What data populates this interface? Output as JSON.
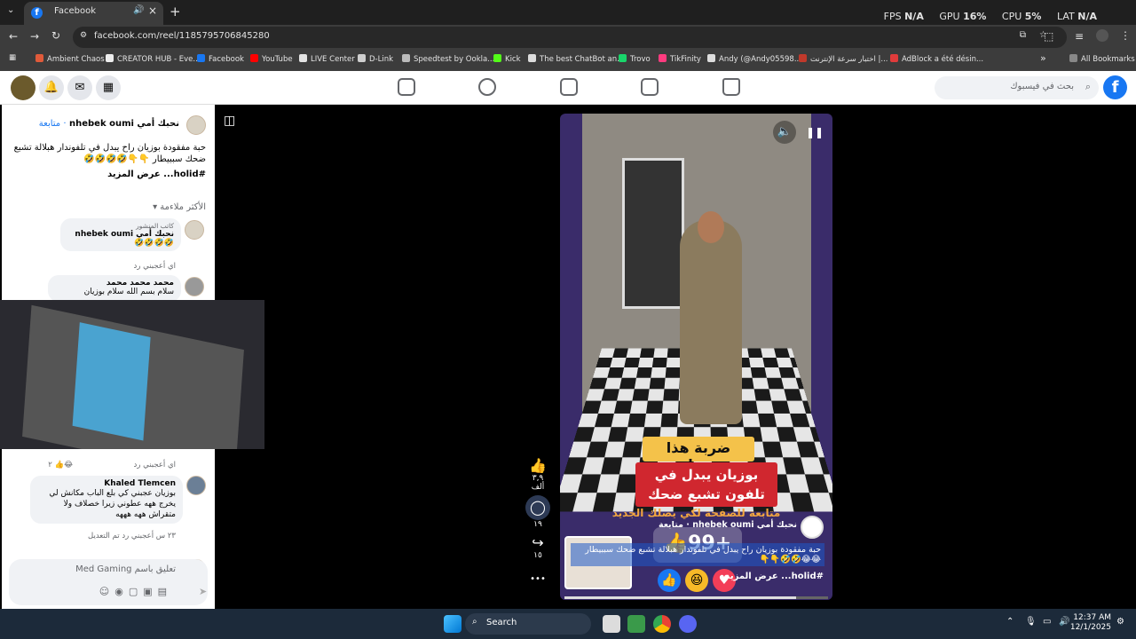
{
  "browser": {
    "tab_title": "Facebook",
    "tab_favicon": "f",
    "new_tab": "+",
    "close_tab": "×",
    "url": "facebook.com/reel/1185795706845280",
    "perf": {
      "fps_label": "FPS",
      "fps_value": "N/A",
      "gpu_label": "GPU",
      "gpu_value": "16%",
      "cpu_label": "CPU",
      "cpu_value": "5%",
      "lat_label": "LAT",
      "lat_value": "N/A"
    },
    "bookmarks": [
      {
        "label": "Ambient Chaos",
        "color": "#e05a3a"
      },
      {
        "label": "CREATOR HUB - Eve...",
        "color": "#eeeeee"
      },
      {
        "label": "Facebook",
        "color": "#1877f2"
      },
      {
        "label": "YouTube",
        "color": "#ff0000"
      },
      {
        "label": "LIVE Center",
        "color": "#e3e3e3"
      },
      {
        "label": "D-Link",
        "color": "#cfcfcf"
      },
      {
        "label": "Speedtest by Ookla...",
        "color": "#bbbbbb"
      },
      {
        "label": "Kick",
        "color": "#53fc18"
      },
      {
        "label": "The best ChatBot an...",
        "color": "#dddddd"
      },
      {
        "label": "Trovo",
        "color": "#19d66b"
      },
      {
        "label": "TikFinity",
        "color": "#ff3b7f"
      },
      {
        "label": "Andy (@Andy05598...",
        "color": "#dddddd"
      },
      {
        "label": "اختبار سرعة الإنترنت |...",
        "color": "#c0392b"
      },
      {
        "label": "AdBlock a été désin...",
        "color": "#e03b3b"
      }
    ],
    "all_bookmarks": "All Bookmarks"
  },
  "fb": {
    "search_placeholder": "بحث في فيسبوك",
    "logo": "f"
  },
  "post": {
    "author": "نحبك أمي nhebek oumi",
    "follow": "متابعة",
    "caption": "حبة مفقودة بوزيان راح يبدل في تلفوندار هبلالة تشبع ضحك سببيطار 👇👇🤣🤣🤣🤣",
    "see_more": "#holid... عرض المزيد",
    "sort": "الأكثر ملاءمة"
  },
  "comments": [
    {
      "badge": "كاتب المنشور",
      "author": "نحبك أمي nhebek oumi",
      "text": "🤣🤣🤣🤣",
      "meta": "اي   أعجبني   رد"
    },
    {
      "author": "محمد محمد محمد",
      "text": "سلام بسم الله سلام بوزيان"
    },
    {
      "meta": "اي   أعجبني   رد",
      "count": "٢"
    },
    {
      "author": "Khaled Tlemcen",
      "text": "بوزيان عجبني كي بلع الباب مكانش لي يخرج ههه عطوني زيرا خصلاف ولا متقراش ههه هههه",
      "meta": "٢٣ س   أعجبني   رد   تم التعديل"
    }
  ],
  "composer": {
    "placeholder": "تعليق باسم Med Gaming"
  },
  "reel": {
    "caption_top": "ضربة هذا بوزيان",
    "caption_main": "بوزيان يبدل في تلفون تشبع ضحك",
    "banner": "متابعة للصفحة لكي يصلك الجديد",
    "author": "نحبك أمي nhebek oumi · متابعة",
    "caption": "حبة مفقودة بوزيان راح يبدل في تلفوندار هبلالة تشبع ضحك سببيطار 😂😂🤣🤣👇👇",
    "see_more": "#holid... عرض المزيد",
    "like_overlay": "99+",
    "progress": 0.88
  },
  "actions": {
    "likes": "٣,٩ ألف",
    "comments": "١٩",
    "shares": "١٥",
    "more": "•••"
  },
  "taskbar": {
    "search": "Search",
    "time": "12:37 AM",
    "date": "12/1/2025"
  }
}
